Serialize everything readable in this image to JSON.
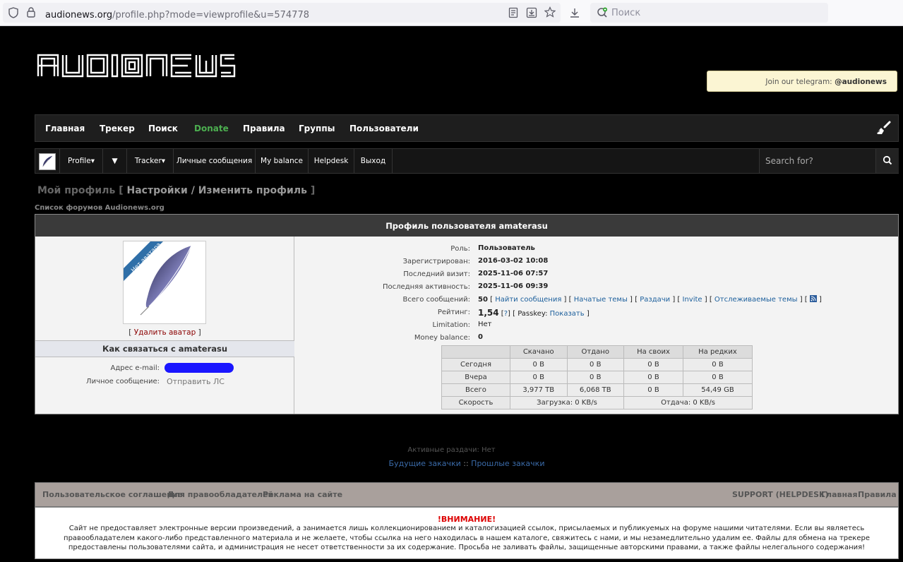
{
  "browser": {
    "url_domain": "audionews.org",
    "url_path": "/profile.php?mode=viewprofile&u=574778",
    "search_placeholder": "Поиск"
  },
  "header": {
    "logo_text": "AUDIONEWS",
    "telegram_prefix": "Join our telegram:",
    "telegram_handle": "@audionews"
  },
  "nav_main": [
    "Главная",
    "Трекер",
    "Поиск",
    "Donate",
    "Правила",
    "Группы",
    "Пользователи"
  ],
  "nav_user": {
    "profile": "Profile",
    "arrow": "▼",
    "tracker": "Tracker",
    "messages": "Личные сообщения",
    "balance": "My balance",
    "helpdesk": "Helpdesk",
    "logout": "Выход",
    "search_placeholder": "Search for?"
  },
  "page_title": {
    "my_profile": "Мой профиль",
    "open": "[",
    "settings": "Настройки / Изменить профиль",
    "close": "]"
  },
  "breadcrumb": "Список форумов Audionews.org",
  "profile": {
    "header": "Профиль пользователя amaterasu",
    "avatar_badge": "Нет аватара",
    "delete_avatar": "Удалить аватар",
    "contact_header": "Как связаться с amaterasu",
    "email_label": "Адрес e-mail:",
    "pm_label": "Личное сообщение:",
    "pm_link": "Отправить ЛС",
    "fields": {
      "role_label": "Роль:",
      "role_value": "Пользователь",
      "reg_label": "Зарегистрирован:",
      "reg_value": "2016-03-02 10:08",
      "visit_label": "Последний визит:",
      "visit_value": "2025-11-06 07:57",
      "activity_label": "Последняя активность:",
      "activity_value": "2025-11-06 09:39",
      "posts_label": "Всего сообщений:",
      "posts_value": "50",
      "posts_links": [
        "Найти сообщения",
        "Начатые темы",
        "Раздачи",
        "Invite",
        "Отслеживаемые темы"
      ],
      "rating_label": "Рейтинг:",
      "rating_value": "1,54",
      "rating_help": "?",
      "passkey_label": "Passkey:",
      "passkey_link": "Показать",
      "limitation_label": "Limitation:",
      "limitation_value": "Нет",
      "money_label": "Money balance:",
      "money_value": "0"
    },
    "stats": {
      "headers": [
        "Скачано",
        "Отдано",
        "На своих",
        "На редких"
      ],
      "rows": [
        {
          "label": "Сегодня",
          "values": [
            "0 B",
            "0 B",
            "0 B",
            "0 B"
          ]
        },
        {
          "label": "Вчера",
          "values": [
            "0 B",
            "0 B",
            "0 B",
            "0 B"
          ]
        },
        {
          "label": "Всего",
          "values": [
            "3,977 TB",
            "6,068 TB",
            "0 B",
            "54,49 GB"
          ]
        }
      ],
      "speed_label": "Скорость",
      "speed_down": "Загрузка: 0 KB/s",
      "speed_up": "Отдача: 0 KB/s"
    }
  },
  "active_seeds": "Активные раздачи: Нет",
  "future_downloads": "Будущие закачки",
  "sep": "::",
  "past_downloads": "Прошлые закачки",
  "footer": {
    "left": [
      "Пользовательское соглашение",
      "Для правообладателей",
      "Реклама на сайте"
    ],
    "right": [
      "SUPPORT (HELPDESK)",
      "Главная",
      "Правила"
    ],
    "warning_title": "!ВНИМАНИЕ!",
    "warning_text": "Сайт не предоставляет электронные версии произведений, а занимается лишь коллекционированием и каталогизацией ссылок, присылаемых и публикуемых на форуме нашими читателями. Если вы являетесь правообладателем какого-либо представленного материала и не желаете, чтобы ссылка на него находилась в нашем каталоге, свяжитесь с нами, и мы незамедлительно удалим ее. Файлы для обмена на трекере предоставлены пользователями сайта, и администрация не несет ответственности за их содержание. Просьба не заливать файлы, защищенные авторскими правами, а также файлы нелегального содержания!"
  }
}
